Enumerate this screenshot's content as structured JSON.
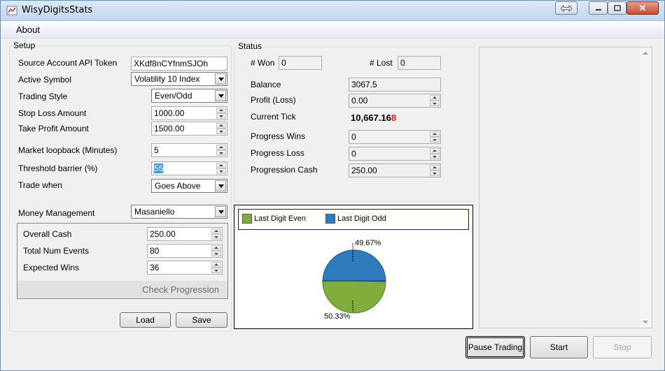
{
  "window": {
    "title": "WisyDigitsStats"
  },
  "menu": {
    "about": "About"
  },
  "setup": {
    "title": "Setup",
    "source_token_label": "Source Account API Token",
    "source_token_value": "XKdf8nCYfnmSJOh",
    "active_symbol_label": "Active Symbol",
    "active_symbol_value": "Volatility 10 Index",
    "trading_style_label": "Trading Style",
    "trading_style_value": "Even/Odd",
    "stop_loss_label": "Stop Loss Amount",
    "stop_loss_value": "1000.00",
    "take_profit_label": "Take Profit Amount",
    "take_profit_value": "1500.00",
    "loopback_label": "Market loopback (Minutes)",
    "loopback_value": "5",
    "threshold_label": "Threshold barrier (%)",
    "threshold_value": "55",
    "trade_when_label": "Trade when",
    "trade_when_value": "Goes Above",
    "money_mgmt_label": "Money Management",
    "money_mgmt_value": "Masaniello",
    "overall_cash_label": "Overall Cash",
    "overall_cash_value": "250.00",
    "total_events_label": "Total Num Events",
    "total_events_value": "80",
    "expected_wins_label": "Expected Wins",
    "expected_wins_value": "36",
    "check_progression": "Check Progression",
    "load_button": "Load",
    "save_button": "Save"
  },
  "status": {
    "title": "Status",
    "won_label": "# Won",
    "won_value": "0",
    "lost_label": "# Lost",
    "lost_value": "0",
    "balance_label": "Balance",
    "balance_value": "3067.5",
    "profit_label": "Profit (Loss)",
    "profit_value": "0.00",
    "current_tick_label": "Current Tick",
    "current_tick_main": "10,667.16",
    "current_tick_last": "8",
    "progress_wins_label": "Progress Wins",
    "progress_wins_value": "0",
    "progress_loss_label": "Progress Loss",
    "progress_loss_value": "0",
    "progression_cash_label": "Progression Cash",
    "progression_cash_value": "250.00"
  },
  "chart_data": {
    "type": "pie",
    "categories": [
      "Last Digit Even",
      "Last Digit Odd"
    ],
    "values": [
      50.33,
      49.67
    ],
    "labels": [
      "50.33%",
      "49.67%"
    ],
    "colors": [
      "#7fae3c",
      "#2f7bbd"
    ],
    "legend_position": "top"
  },
  "controls": {
    "pause_button": "Pause Trading",
    "start_button": "Start",
    "stop_button": "Stop"
  },
  "colors": {
    "tick_last_digit": "#e0201b"
  }
}
